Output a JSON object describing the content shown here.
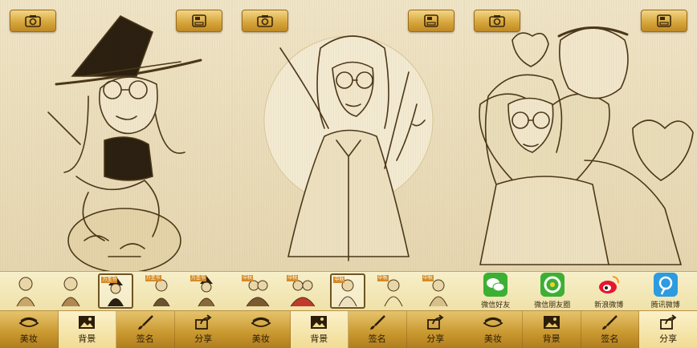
{
  "panels": [
    {
      "id": "halloween",
      "tabs": [
        {
          "label": "美妆",
          "icon": "eye-icon",
          "active": false
        },
        {
          "label": "背景",
          "icon": "image-icon",
          "active": true
        },
        {
          "label": "签名",
          "icon": "brush-icon",
          "active": false
        },
        {
          "label": "分享",
          "icon": "share-icon",
          "active": false
        }
      ],
      "thumbs": [
        {
          "tag": "",
          "selected": false
        },
        {
          "tag": "",
          "selected": false
        },
        {
          "tag": "万圣节",
          "selected": true
        },
        {
          "tag": "万圣节",
          "selected": false
        },
        {
          "tag": "万圣节",
          "selected": false
        }
      ]
    },
    {
      "id": "ancient",
      "tabs": [
        {
          "label": "美妆",
          "icon": "eye-icon",
          "active": false
        },
        {
          "label": "背景",
          "icon": "image-icon",
          "active": true
        },
        {
          "label": "签名",
          "icon": "brush-icon",
          "active": false
        },
        {
          "label": "分享",
          "icon": "share-icon",
          "active": false
        }
      ],
      "thumbs": [
        {
          "tag": "中秋",
          "selected": false
        },
        {
          "tag": "中秋",
          "selected": false
        },
        {
          "tag": "中秋",
          "selected": true
        },
        {
          "tag": "中秋",
          "selected": false
        },
        {
          "tag": "中秋",
          "selected": false
        }
      ]
    },
    {
      "id": "couple",
      "tabs": [
        {
          "label": "美妆",
          "icon": "eye-icon",
          "active": false
        },
        {
          "label": "背景",
          "icon": "image-icon",
          "active": false
        },
        {
          "label": "签名",
          "icon": "brush-icon",
          "active": false
        },
        {
          "label": "分享",
          "icon": "share-icon",
          "active": true
        }
      ],
      "share_targets": [
        {
          "label": "微信好友",
          "icon": "wechat-icon",
          "color": "#3cb034"
        },
        {
          "label": "微信朋友圈",
          "icon": "wechat-moments-icon",
          "color": "#3cb034"
        },
        {
          "label": "新浪微博",
          "icon": "weibo-icon",
          "color": "#e6162d"
        },
        {
          "label": "腾讯微博",
          "icon": "tencent-weibo-icon",
          "color": "#2d9be0"
        }
      ]
    }
  ],
  "colors": {
    "gold": "#d9a93e",
    "paper": "#efe4c6",
    "ink": "#3a2a10"
  }
}
